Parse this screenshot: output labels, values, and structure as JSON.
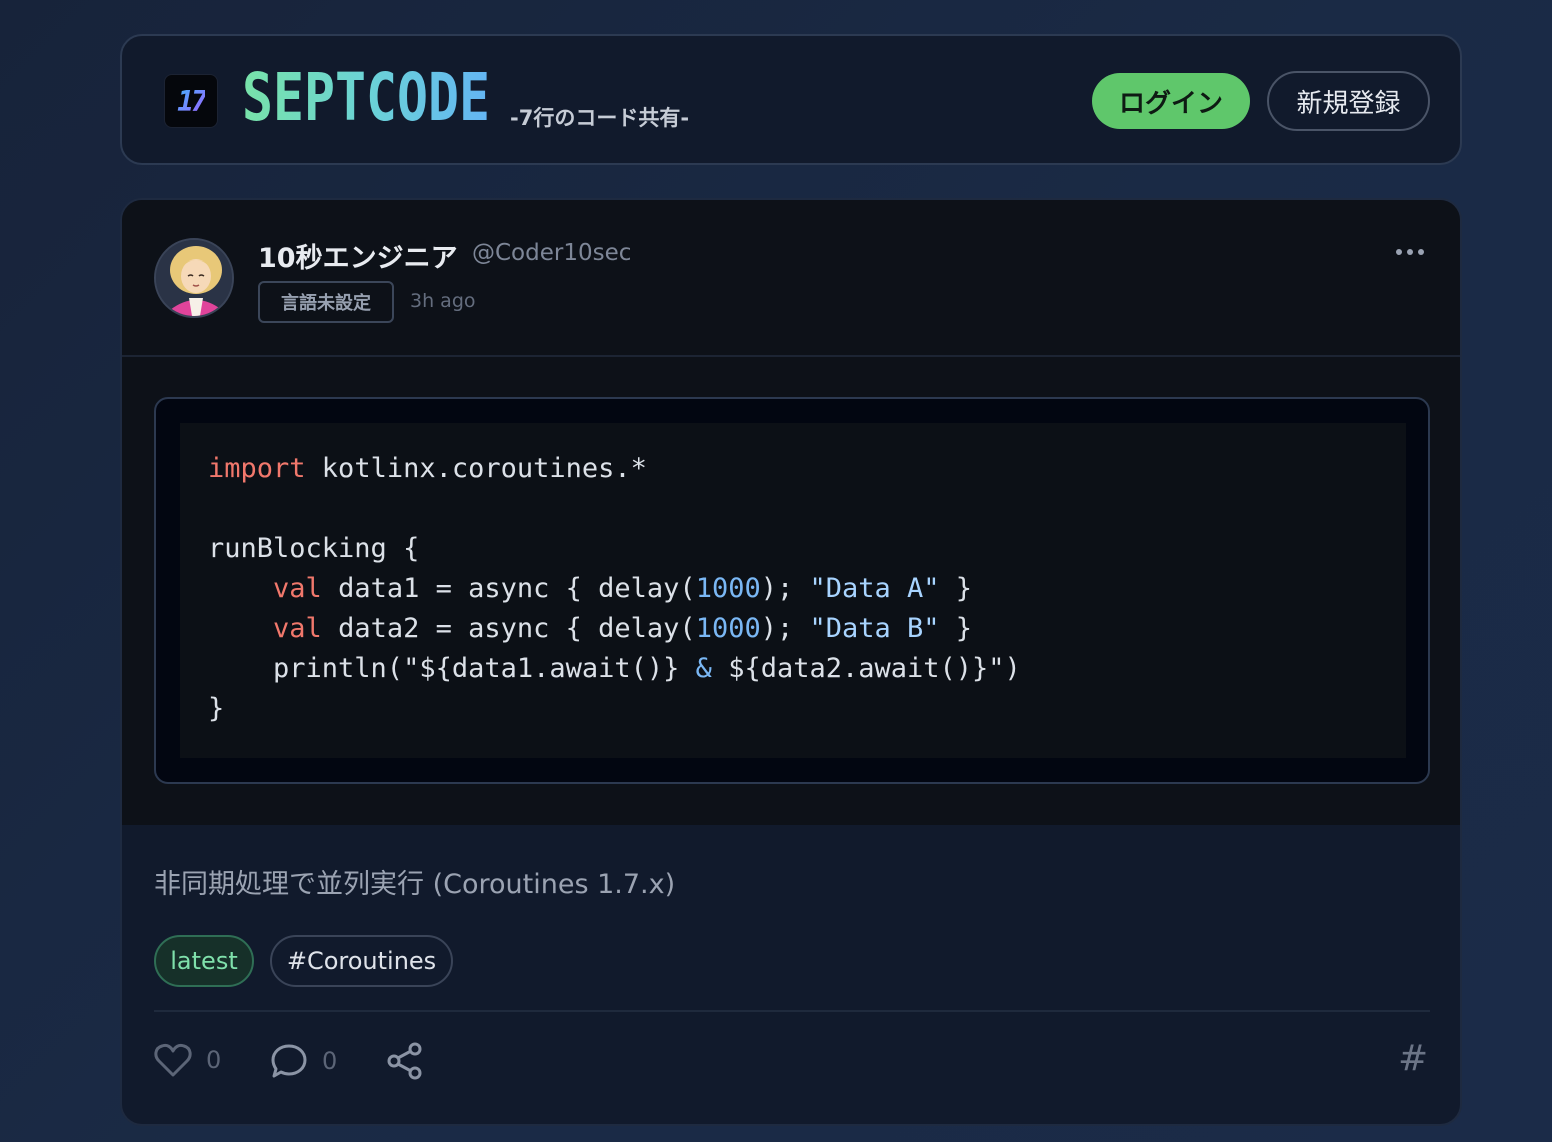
{
  "header": {
    "logo_text": "17",
    "brand": "SEPTCODE",
    "tagline": "-7行のコード共有-",
    "login_label": "ログイン",
    "signup_label": "新規登録"
  },
  "post": {
    "author_name": "10秒エンジニア",
    "author_handle": "@Coder10sec",
    "language_badge": "言語未設定",
    "time_ago": "3h ago",
    "code_lines": [
      "import kotlinx.coroutines.*",
      "",
      "runBlocking {",
      "    val data1 = async { delay(1000); \"Data A\" }",
      "    val data2 = async { delay(1000); \"Data B\" }",
      "    println(\"${data1.await()} & ${data2.await()}\")",
      "}"
    ],
    "description": "非同期処理で並列実行 (Coroutines 1.7.x)",
    "tags": [
      "latest",
      "#Coroutines"
    ],
    "like_count": "0",
    "comment_count": "0",
    "hash_symbol": "#"
  },
  "colors": {
    "accent_green": "#5fc76b",
    "brand_gradient_start": "#78e3a9",
    "brand_gradient_end": "#64b5f4",
    "keyword": "#f1786c",
    "number": "#7ab7f4"
  },
  "icons": [
    "more-icon",
    "heart-icon",
    "comment-icon",
    "share-icon",
    "hash-icon"
  ]
}
